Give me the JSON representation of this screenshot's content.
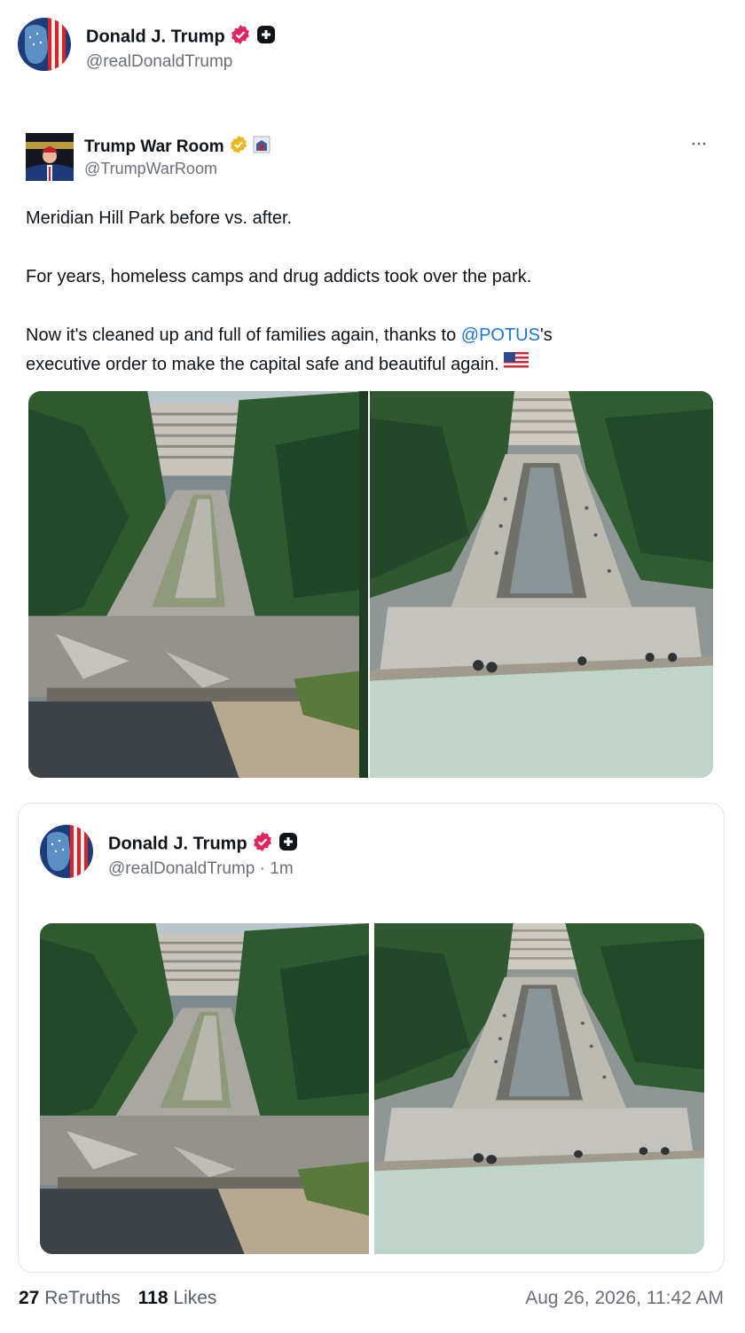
{
  "post": {
    "author_name": "Donald J. Trump",
    "author_handle": "@realDonaldTrump"
  },
  "quoted": {
    "author_name": "Trump War Room",
    "author_handle": "@TrumpWarRoom",
    "more_label": "···",
    "text_line1": "Meridian Hill Park before vs. after.",
    "text_line2": "For years, homeless camps and drug addicts took over the park.",
    "text_line3_pre": "Now it's cleaned up and full of families again, thanks to ",
    "text_mention": "@POTUS",
    "text_line3_post": "'s",
    "text_line4": "executive order to make the capital safe and beautiful again.",
    "flag_icon": "us-flag-icon"
  },
  "embedded": {
    "author_name": "Donald J. Trump",
    "author_handle": "@realDonaldTrump",
    "time_ago": "· 1m"
  },
  "stats": {
    "retruths_count": "27",
    "retruths_label": "ReTruths",
    "likes_count": "118",
    "likes_label": "Likes",
    "timestamp": "Aug 26, 2026, 11:42 AM"
  },
  "colors": {
    "verified_red": "#e0245e",
    "verified_gold": "#e8b923",
    "link_blue": "#1d74d8"
  }
}
